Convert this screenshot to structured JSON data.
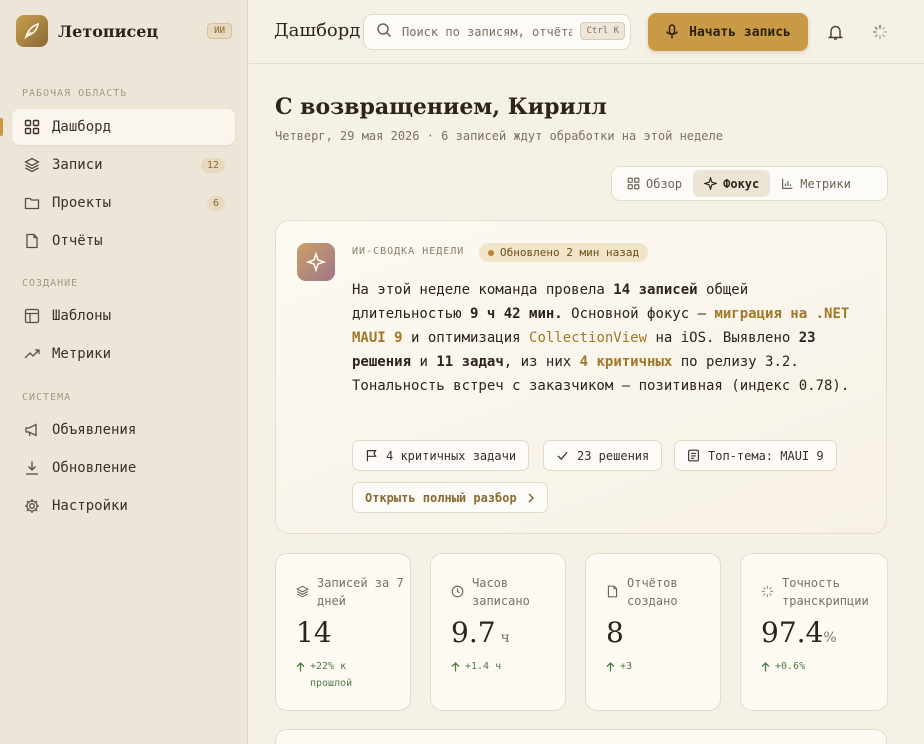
{
  "app": {
    "name": "Летописец",
    "badge": "ИИ"
  },
  "sidebar": {
    "sections": [
      "РАБОЧАЯ ОБЛАСТЬ",
      "СОЗДАНИЕ",
      "СИСТЕМА"
    ],
    "items": [
      {
        "label": "Дашборд",
        "icon": "grid-icon",
        "active": true
      },
      {
        "label": "Записи",
        "icon": "layers-icon",
        "count": "12"
      },
      {
        "label": "Проекты",
        "icon": "folder-icon",
        "count": "6"
      },
      {
        "label": "Отчёты",
        "icon": "document-icon"
      },
      {
        "label": "Шаблоны",
        "icon": "template-icon"
      },
      {
        "label": "Метрики",
        "icon": "trend-icon"
      },
      {
        "label": "Объявления",
        "icon": "megaphone-icon"
      },
      {
        "label": "Обновление",
        "icon": "download-icon"
      },
      {
        "label": "Настройки",
        "icon": "gear-icon"
      }
    ]
  },
  "topbar": {
    "title": "Дашборд",
    "search_placeholder": "Поиск по записям, отчётам, проектам",
    "shortcut": "Ctrl K",
    "record_label": "Начать запись"
  },
  "main": {
    "welcome": "С возвращением, Кирилл",
    "subline": "Четверг, 29 мая 2026 · 6 записей ждут обработки на этой неделе",
    "view_tabs": [
      {
        "label": "Обзор",
        "active": false
      },
      {
        "label": "Фокус",
        "active": true
      },
      {
        "label": "Метрики",
        "active": false
      }
    ]
  },
  "ai_summary": {
    "kicker": "ИИ-СВОДКА НЕДЕЛИ",
    "updated": "Обновлено 2 мин назад",
    "text": {
      "p1": "На этой неделе команда провела ",
      "b1": "14 записей",
      "p2": " общей длительностью ",
      "b2": "9 ч 42 мин.",
      "p3": " Основной фокус — ",
      "h1": "миграция на .NET MAUI 9",
      "p4": " и оптимизация ",
      "h2": "CollectionView",
      "p5": " на iOS. Выявлено ",
      "b3": "23 решения",
      "p6": " и ",
      "b4": "11 задач",
      "p7": ", из них ",
      "h3": "4 критичных",
      "p8": " по релизу 3.2. Тональность встреч с заказчиком — позитивная (индекс 0.78)."
    },
    "chips": [
      {
        "label": "4 критичных задачи",
        "icon": "flag-icon"
      },
      {
        "label": "23 решения",
        "icon": "check-icon"
      },
      {
        "label": "Топ-тема: MAUI 9",
        "icon": "note-icon"
      }
    ],
    "open_label": "Открыть полный разбор"
  },
  "stats": [
    {
      "label": "Записей за 7 дней",
      "value": "14",
      "unit": "",
      "delta": "+22% к прошлой",
      "icon": "layers-icon"
    },
    {
      "label": "Часов записано",
      "value": "9.7",
      "unit": "ч",
      "delta": "+1.4 ч",
      "icon": "clock-icon"
    },
    {
      "label": "Отчётов создано",
      "value": "8",
      "unit": "",
      "delta": "+3",
      "icon": "document-icon"
    },
    {
      "label": "Точность транскрипции",
      "value": "97.4",
      "unit": "%",
      "delta": "+0.6%",
      "icon": "spinner-icon"
    }
  ],
  "colors": {
    "accent": "#c89a45",
    "highlight": "#a07828",
    "positive": "#4f7a45",
    "sidebar_bg": "#ede6d8",
    "page_bg": "#f6f1e7"
  }
}
